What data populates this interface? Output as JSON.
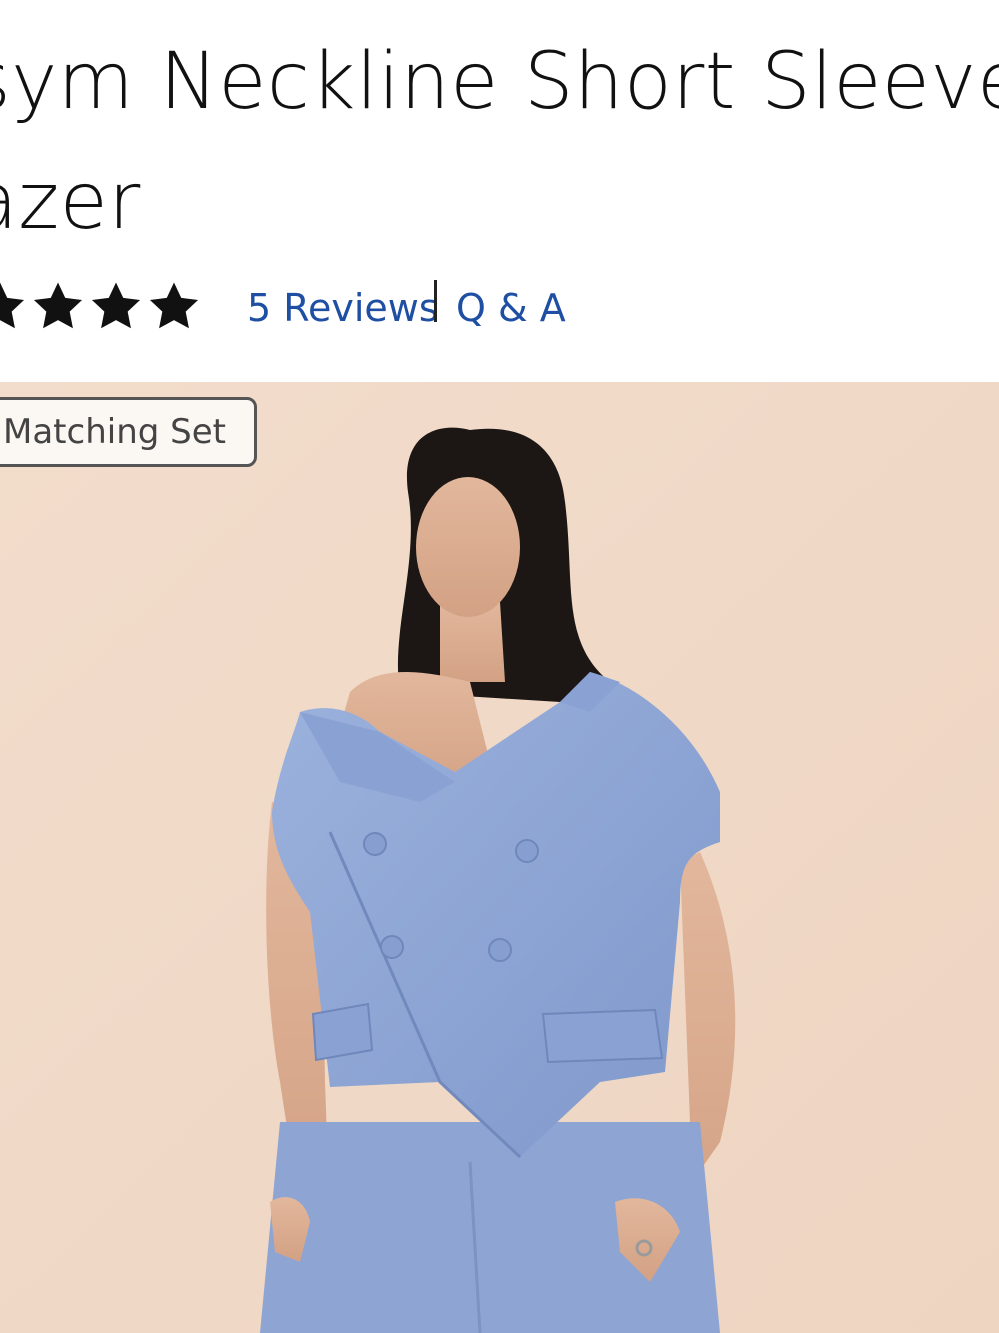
{
  "product": {
    "title_line1": "sym Neckline Short Sleeve",
    "title_line2": "azer"
  },
  "rating": {
    "stars_visible": 4,
    "reviews_label": "5 Reviews",
    "qa_label": "Q & A"
  },
  "hero": {
    "badge_label": "Matching Set",
    "background_color": "#f0d8c6",
    "garment_color": "#8fa7d6"
  },
  "colors": {
    "link": "#1f4fa3",
    "text": "#111111"
  }
}
